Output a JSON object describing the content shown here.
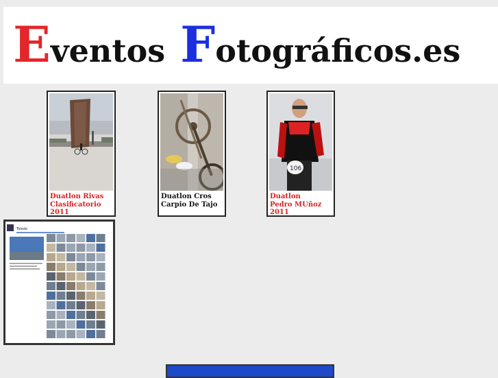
{
  "header": {
    "logo": {
      "word1_initial": "E",
      "word1_rest": "ventos",
      "word2_initial": "F",
      "word2_rest": "otográficos.es",
      "initial1_color": "#e3262a",
      "initial2_color": "#1b2ee0"
    }
  },
  "events": [
    {
      "title_line1": "Duatlon Rivas",
      "title_line2": "Clasificatorio",
      "title_line3": "2011",
      "caption_color": "#d62020"
    },
    {
      "title_line1": "Duatlon Cros",
      "title_line2": "Carpio De Tajo",
      "title_line3": "",
      "caption_color": "#111111"
    },
    {
      "title_line1": "Duatlon",
      "title_line2": "Pedro MUñoz",
      "title_line3": "2011",
      "caption_color": "#d62020"
    }
  ],
  "gallery_preview": {
    "album_title": "Toledo"
  }
}
